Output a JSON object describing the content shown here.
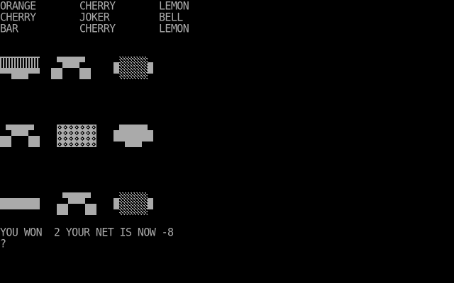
{
  "colors": {
    "background": "#000000",
    "foreground": "#aaaaaa"
  },
  "reel_names": [
    [
      "ORANGE",
      "CHERRY",
      "LEMON"
    ],
    [
      "CHERRY",
      "JOKER",
      "BELL"
    ],
    [
      "BAR",
      "CHERRY",
      "LEMON"
    ]
  ],
  "reel_symbols": [
    [
      "orange",
      "cherry",
      "lemon"
    ],
    [
      "cherry",
      "joker",
      "bell"
    ],
    [
      "bar",
      "cherry",
      "lemon"
    ]
  ],
  "result": {
    "message": "YOU WON  2 YOUR NET IS NOW -8",
    "prompt": "?"
  }
}
